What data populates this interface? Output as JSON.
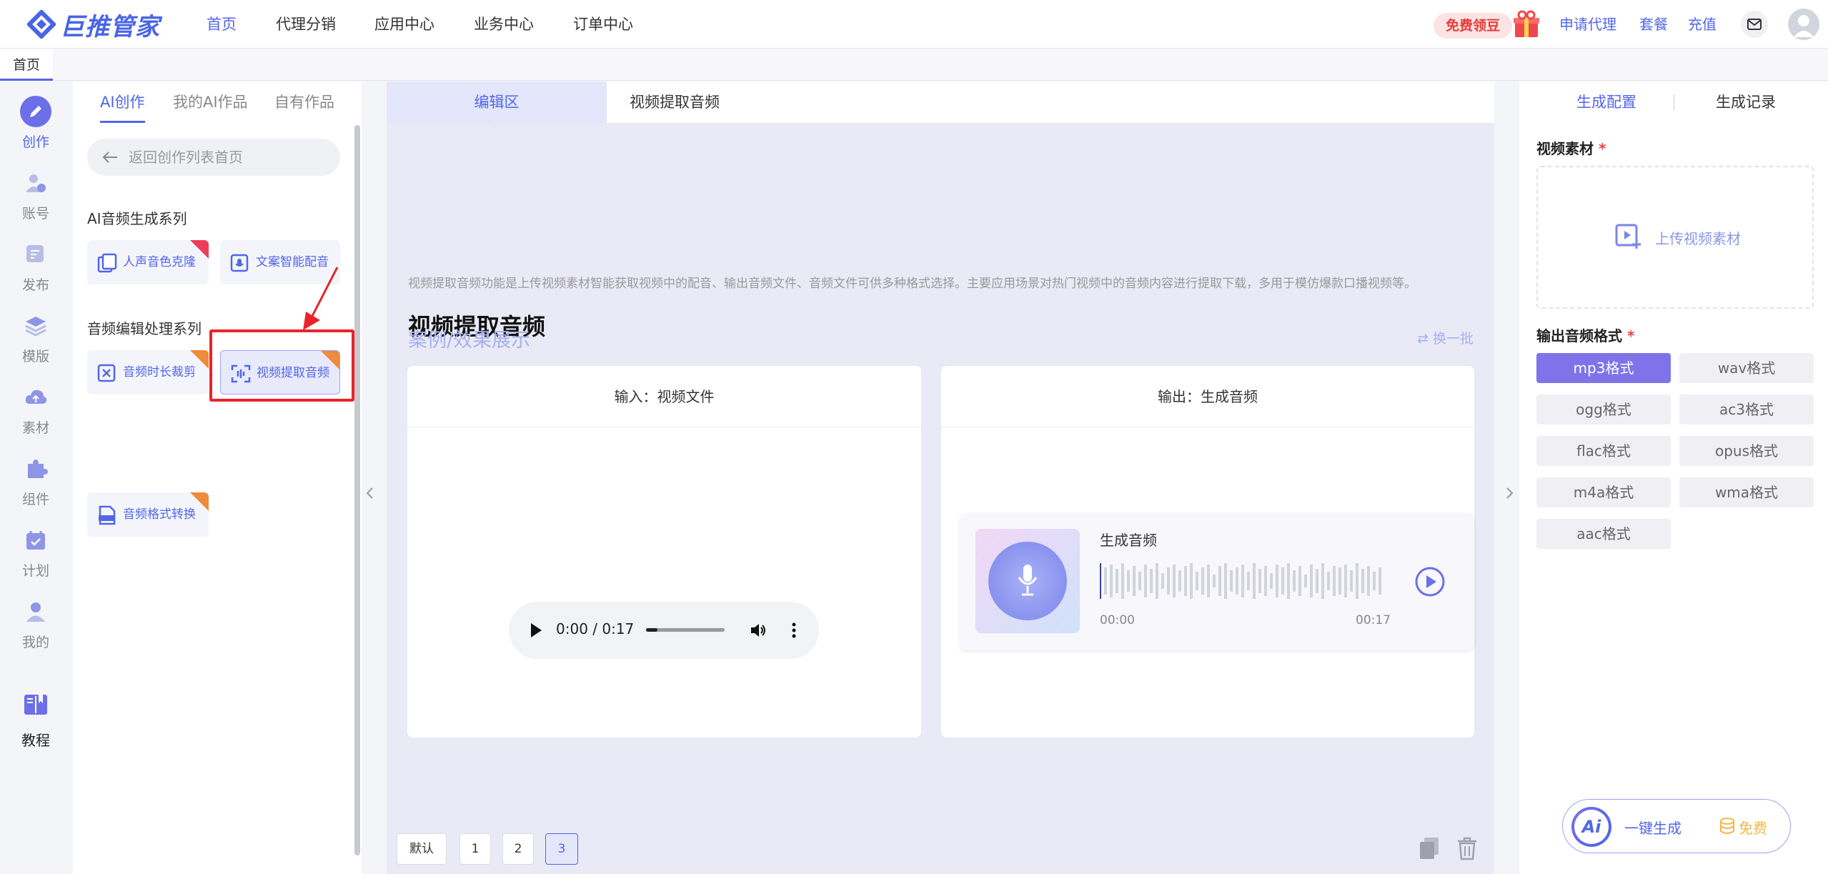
{
  "brand": {
    "name": "巨推管家"
  },
  "nav": {
    "items": [
      "首页",
      "代理分销",
      "应用中心",
      "业务中心",
      "订单中心"
    ]
  },
  "top_right": {
    "free_label": "免费领豆",
    "apply_agent": "申请代理",
    "package": "套餐",
    "recharge": "充值"
  },
  "page_tabs": {
    "home": "首页"
  },
  "rail": {
    "items": [
      "创作",
      "账号",
      "发布",
      "模版",
      "素材",
      "组件",
      "计划",
      "我的",
      "教程"
    ]
  },
  "panel": {
    "tabs": [
      "AI创作",
      "我的AI作品",
      "自有作品"
    ],
    "back_label": "返回创作列表首页",
    "section1": "AI音频生成系列",
    "section1_cards": [
      "人声音色克隆",
      "文案智能配音"
    ],
    "section2": "音频编辑处理系列",
    "section2_cards": [
      "音频时长裁剪",
      "视频提取音频",
      "音频格式转换"
    ]
  },
  "center": {
    "tabs": [
      "编辑区",
      "视频提取音频"
    ],
    "heading": "视频提取音频",
    "desc": "视频提取音频功能是上传视频素材智能获取视频中的配音、输出音频文件、音频文件可供多种格式选择。主要应用场景对热门视频中的音频内容进行提取下载，多用于模仿爆款口播视频等。",
    "case_title": "案例/效果展示",
    "refresh": "换一批",
    "input_title": "输入：视频文件",
    "output_title": "输出：生成音频",
    "player_time": "0:00 / 0:17",
    "audio_title": "生成音频",
    "audio_start": "00:00",
    "audio_end": "00:17",
    "pager": [
      "默认",
      "1",
      "2",
      "3"
    ],
    "pager_selected": "3"
  },
  "right": {
    "tabs": [
      "生成配置",
      "生成记录"
    ],
    "video_label": "视频素材",
    "upload_label": "上传视频素材",
    "format_label": "输出音频格式",
    "formats": [
      "mp3格式",
      "wav格式",
      "ogg格式",
      "ac3格式",
      "flac格式",
      "opus格式",
      "m4a格式",
      "wma格式",
      "aac格式"
    ],
    "selected_format": "mp3格式",
    "generate": "一键生成",
    "free": "免费"
  },
  "colors": {
    "accent": "#5266e8",
    "selected_format": "#7f73ea",
    "highlight_box": "#e8242a"
  }
}
